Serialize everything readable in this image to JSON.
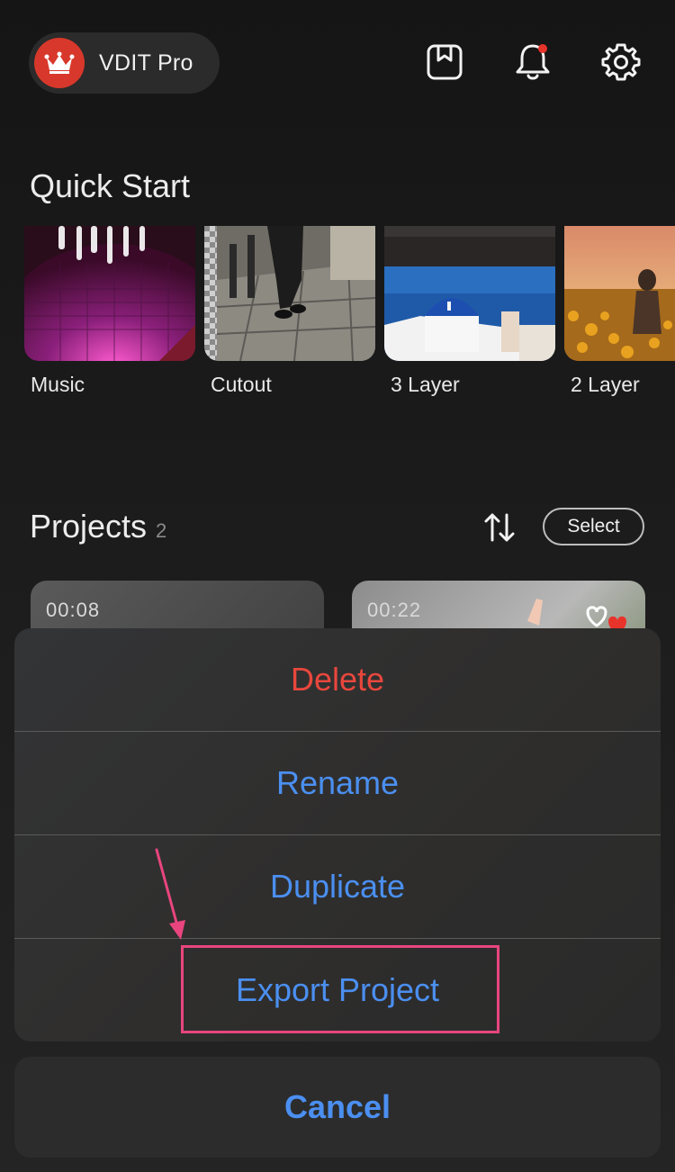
{
  "header": {
    "pro_label": "VDIT Pro"
  },
  "quick_start": {
    "title": "Quick Start",
    "items": [
      {
        "label": "Music"
      },
      {
        "label": "Cutout"
      },
      {
        "label": "3 Layer"
      },
      {
        "label": "2 Layer"
      }
    ]
  },
  "projects": {
    "title": "Projects",
    "count": "2",
    "select_label": "Select",
    "items": [
      {
        "duration": "00:08"
      },
      {
        "duration": "00:22"
      }
    ]
  },
  "action_sheet": {
    "items": [
      {
        "label": "Delete",
        "color": "#e8473d"
      },
      {
        "label": "Rename",
        "color": "#4b8ff0"
      },
      {
        "label": "Duplicate",
        "color": "#4b8ff0"
      },
      {
        "label": "Export Project",
        "color": "#4b8ff0"
      }
    ],
    "cancel_label": "Cancel"
  },
  "colors": {
    "accent_blue": "#4b8ff0",
    "destructive_red": "#e8473d",
    "highlight_pink": "#e8457e",
    "crown_badge": "#d8382b"
  },
  "icons": [
    "crown-icon",
    "bookmark-icon",
    "bell-icon",
    "gear-icon",
    "sort-icon"
  ]
}
